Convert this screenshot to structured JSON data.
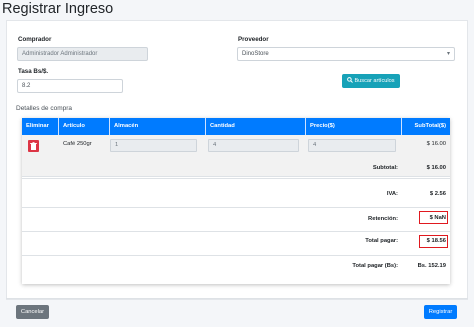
{
  "page": {
    "title": "Registrar Ingreso"
  },
  "form": {
    "buyer_label": "Comprador",
    "buyer_value": "Administrador  Administrador",
    "supplier_label": "Proveedor",
    "supplier_value": "DinoStore",
    "rate_label": "Tasa Bs/$.",
    "rate_value": "8.2",
    "search_button": "Buscar artículos"
  },
  "details": {
    "title": "Detalles de compra",
    "columns": [
      "Eliminar",
      "Artículo",
      "Almacén",
      "Cantidad",
      "Precio($)",
      "SubTotal($)"
    ],
    "rows": [
      {
        "article": "Café 250gr",
        "warehouse": "1",
        "quantity": "4",
        "price": "4",
        "subtotal": "$ 16.00"
      }
    ],
    "totals": [
      {
        "label": "Subtotal:",
        "value": "$ 16.00"
      },
      {
        "label": "IVA:",
        "value": "$ 2.56"
      },
      {
        "label": "Retención:",
        "value": "$ NaN"
      },
      {
        "label": "Total pagar:",
        "value": "$ 18.56"
      },
      {
        "label": "Total pagar (Bs):",
        "value": "Bs. 152.19"
      }
    ]
  },
  "footer": {
    "cancel_button": "Cancelar",
    "save_button": "Registrar"
  },
  "colors": {
    "primary": "#007bff",
    "info": "#17a2b8",
    "danger": "#dc3545",
    "secondary": "#6c757d",
    "highlight": "#e0191f"
  },
  "icons": {
    "search": "search-icon",
    "delete": "trash-icon",
    "dropdown": "chevron-down-icon"
  }
}
